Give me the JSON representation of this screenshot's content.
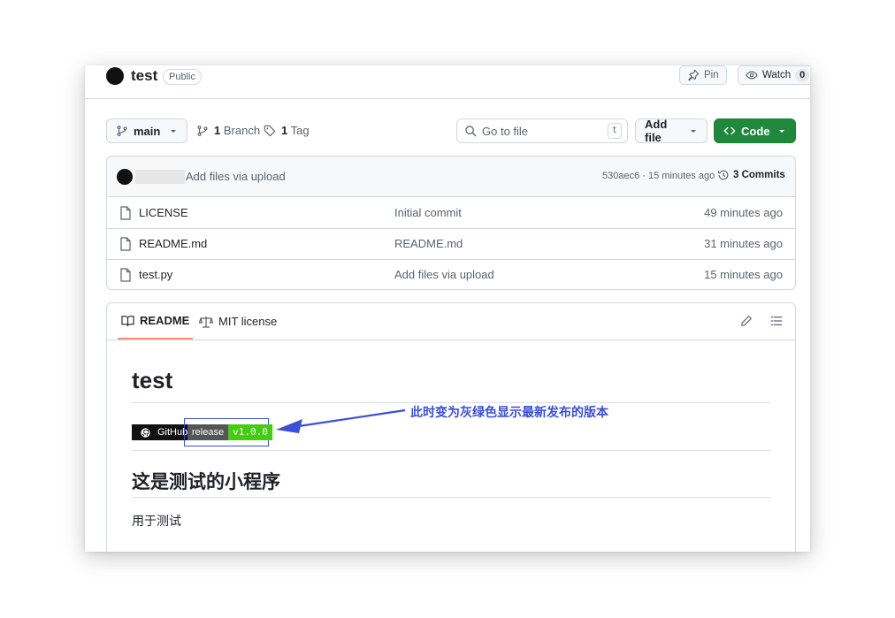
{
  "repo": {
    "name": "test",
    "visibility": "Public",
    "pin_label": "Pin",
    "watch_label": "Watch",
    "watch_count": "0"
  },
  "toolbar": {
    "branch": "main",
    "branch_count": "1",
    "branch_label": "Branch",
    "tag_count": "1",
    "tag_label": "Tag",
    "search_placeholder": "Go to file",
    "search_shortcut": "t",
    "add_file_label": "Add file",
    "code_label": "Code"
  },
  "latest_commit": {
    "message": "Add files via upload",
    "hash": "530aec6",
    "time": "15 minutes ago",
    "hash_time": "530aec6 · 15 minutes ago",
    "commits_label": "3 Commits"
  },
  "files": [
    {
      "name": "LICENSE",
      "message": "Initial commit",
      "time": "49 minutes ago"
    },
    {
      "name": "README.md",
      "message": "README.md",
      "time": "31 minutes ago"
    },
    {
      "name": "test.py",
      "message": "Add files via upload",
      "time": "15 minutes ago"
    }
  ],
  "readme": {
    "tab_readme": "README",
    "tab_license": "MIT license",
    "title": "test",
    "badge_github": "GitHub",
    "badge_release_label": "release",
    "badge_release_value": "v1.0.0",
    "heading2": "这是测试的小程序",
    "paragraph": "用于测试"
  },
  "annotation": {
    "text": "此时变为灰绿色显示最新发布的版本",
    "color": "#3b4fd8"
  },
  "colors": {
    "code_button": "#1f883d",
    "tab_underline": "#fd8c73",
    "badge_release_value_bg": "#4c1",
    "badge_label_bg": "#555555"
  }
}
